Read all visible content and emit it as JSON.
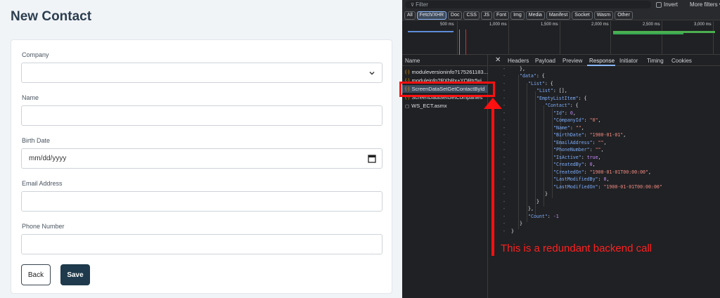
{
  "app": {
    "title": "New Contact",
    "fields": [
      {
        "label": "Company",
        "value": "",
        "type": "select"
      },
      {
        "label": "Name",
        "value": "",
        "type": "text"
      },
      {
        "label": "Birth Date",
        "value": "mm/dd/yyyy",
        "type": "date"
      },
      {
        "label": "Email Address",
        "value": "",
        "type": "text"
      },
      {
        "label": "Phone Number",
        "value": "",
        "type": "text"
      }
    ],
    "buttons": {
      "back": "Back",
      "save": "Save"
    }
  },
  "devtools": {
    "filter_placeholder": "Filter",
    "invert_label": "Invert",
    "more_filters_label": "More filters ▾",
    "type_filters": [
      "All",
      "Fetch/XHR",
      "Doc",
      "CSS",
      "JS",
      "Font",
      "Img",
      "Media",
      "Manifest",
      "Socket",
      "Wasm",
      "Other"
    ],
    "active_type": "Fetch/XHR",
    "timeline_ticks": [
      "500 ms",
      "1,000 ms",
      "1,500 ms",
      "2,000 ms",
      "2,500 ms",
      "3,000 ms"
    ],
    "name_header": "Name",
    "requests": [
      {
        "name": "moduleversioninfo?175261183...",
        "icon": "json-icon"
      },
      {
        "name": "moduleinfo?RXbRx+YORtr5vi",
        "icon": "json-icon"
      },
      {
        "name": "ScreenDataSetGetContactById",
        "icon": "json-icon"
      },
      {
        "name": "ScreenDataSetGetCompanies",
        "icon": "json-icon"
      },
      {
        "name": "WS_ECT.asmx",
        "icon": "document-icon"
      }
    ],
    "tabs": [
      "Headers",
      "Payload",
      "Preview",
      "Response",
      "Initiator",
      "Timing",
      "Cookies"
    ],
    "active_tab": "Response"
  },
  "annotation": {
    "text": "This is a redundant backend call",
    "color": "#ff1010"
  }
}
